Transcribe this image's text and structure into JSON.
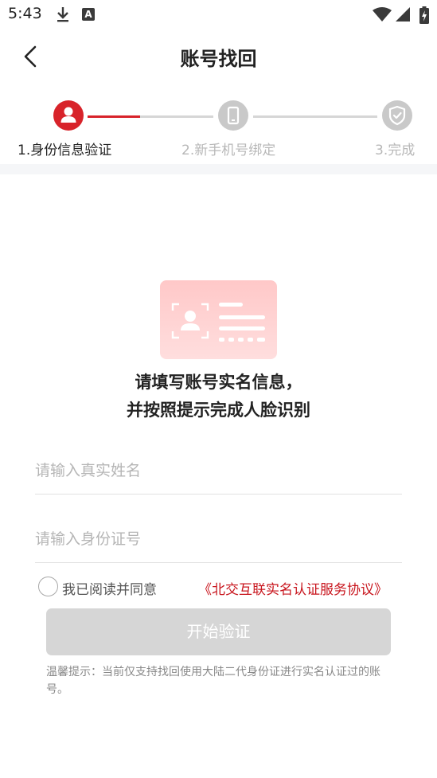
{
  "status_bar": {
    "time": "5:43",
    "icons": [
      "download-icon",
      "app-a-icon",
      "wifi-icon",
      "signal-icon",
      "battery-icon"
    ],
    "app_icon_letter": "A"
  },
  "header": {
    "title": "账号找回",
    "back_icon": "chevron-left-icon"
  },
  "steps": [
    {
      "label": "1.身份信息验证",
      "icon": "person-icon",
      "state": "active"
    },
    {
      "label": "2.新手机号绑定",
      "icon": "phone-icon",
      "state": "pending"
    },
    {
      "label": "3.完成",
      "icon": "shield-check-icon",
      "state": "pending"
    }
  ],
  "step_progress": 0.42,
  "main": {
    "illustration": "id-card-icon",
    "prompt_line1": "请填写账号实名信息，",
    "prompt_line2": "并按照提示完成人脸识别"
  },
  "form": {
    "name_placeholder": "请输入真实姓名",
    "id_placeholder": "请输入身份证号",
    "name_value": "",
    "id_value": ""
  },
  "agreement": {
    "checked": false,
    "text": "我已阅读并同意",
    "link": "《北交互联实名认证服务协议》"
  },
  "start_button": {
    "label": "开始验证",
    "enabled": false
  },
  "tip": "温馨提示：当前仅支持找回使用大陆二代身份证进行实名认证过的账号。",
  "colors": {
    "accent": "#d8232a",
    "link": "#c8151d",
    "inactive": "#c9c9c9",
    "button_disabled": "#d6d6d6"
  }
}
